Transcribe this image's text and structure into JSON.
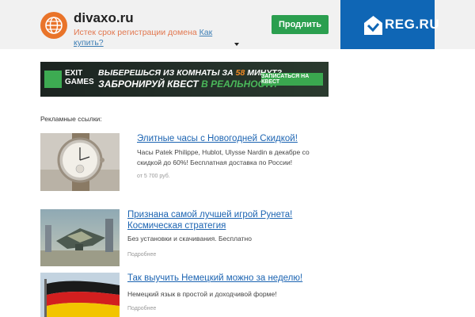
{
  "header": {
    "domain": "divaxo.ru",
    "expired_text": "Истек срок регистрации домена ",
    "buy_link": "Как купить?",
    "buy_button": "Продлить",
    "registrar": "REG.RU"
  },
  "banner": {
    "brand_line1": "EXIT",
    "brand_line2": "GAMES",
    "line1_before": "ВЫБЕРЕШЬСЯ ИЗ КОМНАТЫ ЗА ",
    "line1_highlight": "58",
    "line1_after": " МИНУТ?",
    "line2_before": "ЗАБРОНИРУЙ КВЕСТ ",
    "line2_highlight": "В РЕАЛЬНОСТИ",
    "cta": "ЗАПИСАТЬСЯ НА КВЕСТ"
  },
  "ads_label": "Рекламные ссылки:",
  "ads": [
    {
      "title": "Элитные часы с Новогодней Скидкой!",
      "description": "Часы Patek Philippe, Hublot, Ulysse Nardin в декабре со скидкой до 60%! Бесплатная доставка по России!",
      "meta": "от 5 700 руб."
    },
    {
      "title": "Признана самой лучшей игрой Рунета! Космическая стратегия",
      "description": "Без установки и скачивания. Бесплатно",
      "meta": "Подробнее"
    },
    {
      "title": "Так выучить Немецкий можно за неделю!",
      "description": "Немецкий язык в простой и доходчивой форме!",
      "meta": "Подробнее"
    }
  ],
  "colors": {
    "header_bg": "#f1f1f1",
    "accent_orange": "#e9742a",
    "button_green": "#2b9f4f",
    "reg_blue": "#0f66b5",
    "link_blue": "#1c64b2"
  }
}
